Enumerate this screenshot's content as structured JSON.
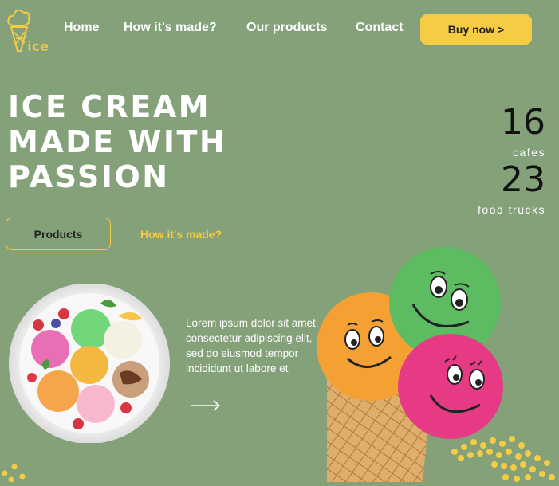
{
  "brand": {
    "logo_text": "ice"
  },
  "nav": {
    "links": [
      "Home",
      "How it's made?",
      "Our products",
      "Contact"
    ],
    "buy_label": "Buy now >"
  },
  "hero": {
    "title_lines": [
      "ICE CREAM",
      "MADE WITH",
      "PASSION"
    ],
    "primary_button": "Products",
    "secondary_link": "How it's made?"
  },
  "stats": [
    {
      "value": "16",
      "label": "cafes"
    },
    {
      "value": "23",
      "label": "food trucks"
    }
  ],
  "description": "Lorem ipsum dolor sit amet, consectetur adipiscing elit, sed do eiusmod tempor incididunt ut labore et",
  "colors": {
    "background": "#84a17a",
    "accent": "#f5cc44",
    "text": "#ffffff"
  },
  "icons": {
    "arrow": "arrow-right-icon",
    "logo": "ice-cream-logo-icon"
  }
}
